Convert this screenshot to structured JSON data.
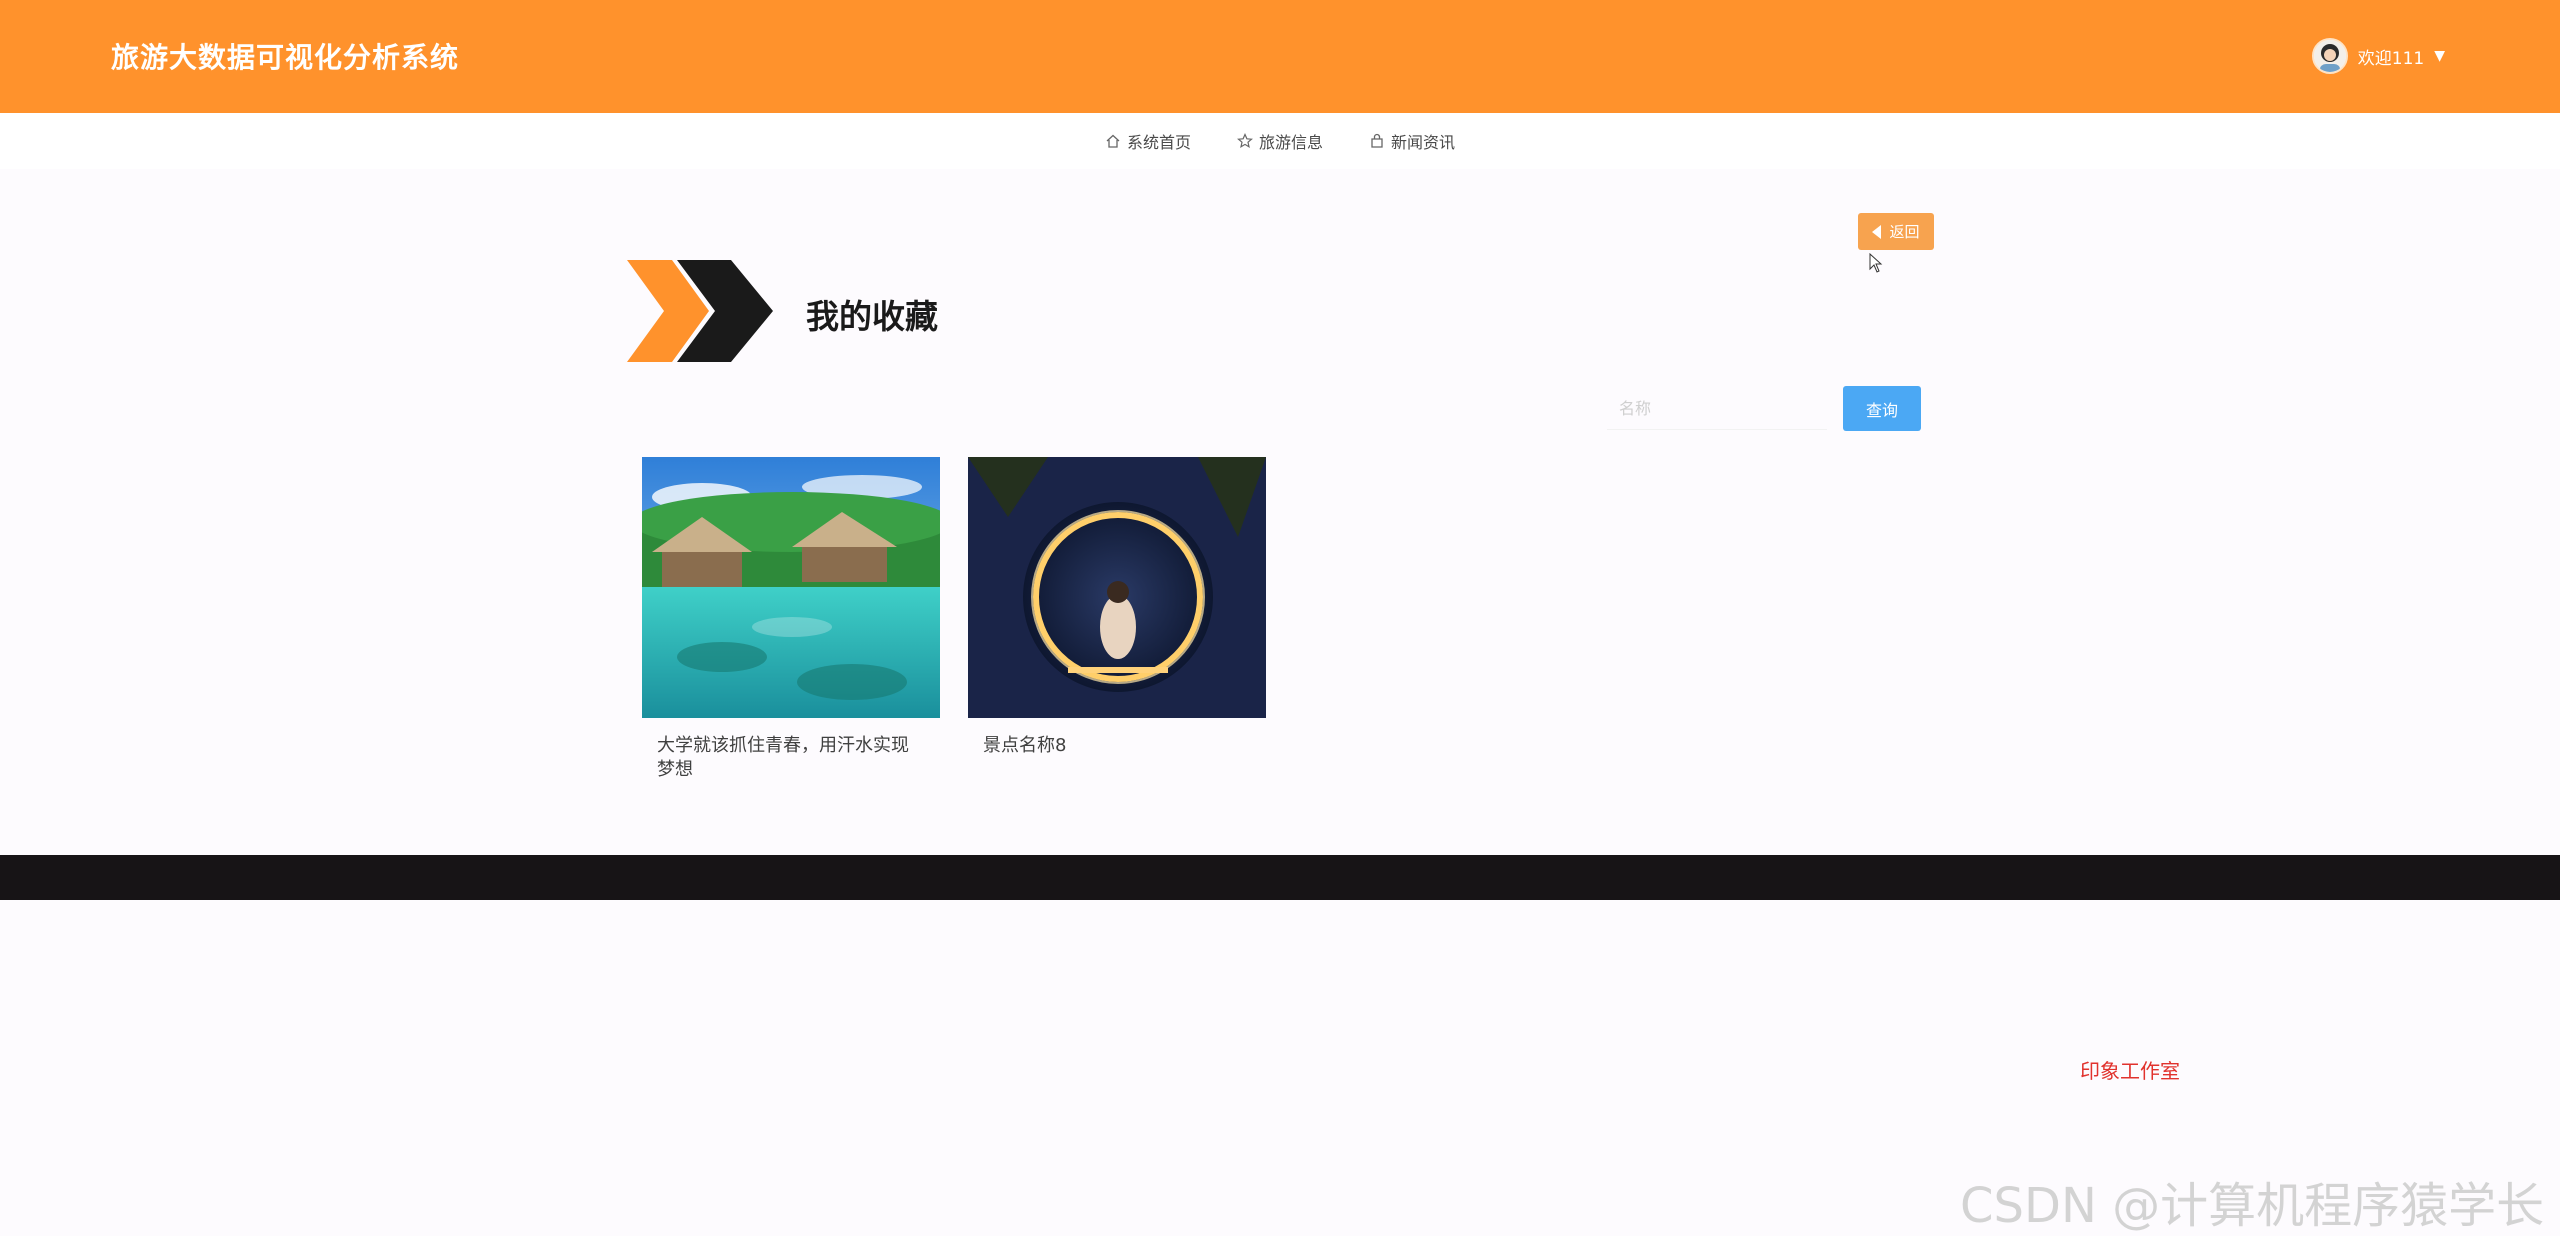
{
  "header": {
    "title": "旅游大数据可视化分析系统",
    "welcome": "欢迎111",
    "caret": "▼"
  },
  "nav": {
    "items": [
      {
        "label": "系统首页",
        "icon": "home-icon"
      },
      {
        "label": "旅游信息",
        "icon": "star-icon"
      },
      {
        "label": "新闻资讯",
        "icon": "bag-icon"
      }
    ]
  },
  "back_button": {
    "label": "返回"
  },
  "page": {
    "title": "我的收藏"
  },
  "search": {
    "placeholder": "名称",
    "button_label": "查询"
  },
  "cards": [
    {
      "title": "大学就该抓住青春，用汗水实现梦想"
    },
    {
      "title": "景点名称8"
    }
  ],
  "footer": {
    "studio": "印象工作室"
  },
  "watermark": "CSDN @计算机程序猿学长",
  "colors": {
    "header_bg": "#ff922c",
    "accent_orange": "#f7a34f",
    "button_blue": "#4ba8f4",
    "footer_bg": "#171416",
    "studio_red": "#e1322d"
  }
}
